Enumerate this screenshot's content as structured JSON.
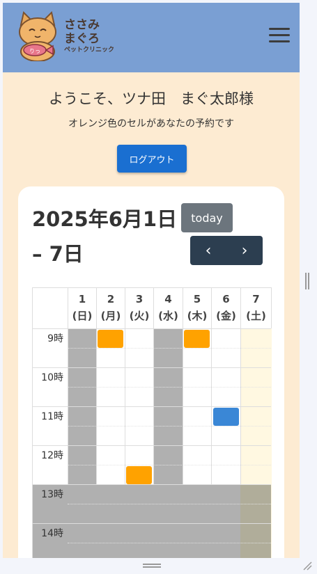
{
  "header": {
    "logo_line1": "ささみ",
    "logo_line2": "まぐろ",
    "logo_sub": "ペットクリニック",
    "fish_label": "りっ",
    "menu_icon": "hamburger-icon",
    "bg_color": "#7a9fd3"
  },
  "welcome": {
    "title": "ようこそ、ツナ田　まぐ太郎様",
    "note": "オレンジ色のセルがあなたの予約です"
  },
  "logout_label": "ログアウト",
  "calendar": {
    "title": "2025年6月1日 – 7日",
    "today_label": "today",
    "prev_icon": "‹",
    "next_icon": "›",
    "days": [
      {
        "num": "1",
        "wd": "(日)"
      },
      {
        "num": "2",
        "wd": "(月)"
      },
      {
        "num": "3",
        "wd": "(火)"
      },
      {
        "num": "4",
        "wd": "(水)"
      },
      {
        "num": "5",
        "wd": "(木)"
      },
      {
        "num": "6",
        "wd": "(金)"
      },
      {
        "num": "7",
        "wd": "(土)"
      }
    ],
    "hours": [
      "9時",
      "10時",
      "11時",
      "12時",
      "13時",
      "14時"
    ],
    "colors": {
      "mine": "#ffa200",
      "other": "#3a87d6",
      "closed": "#b0b0b0",
      "today_bg": "#fff8e1"
    }
  }
}
